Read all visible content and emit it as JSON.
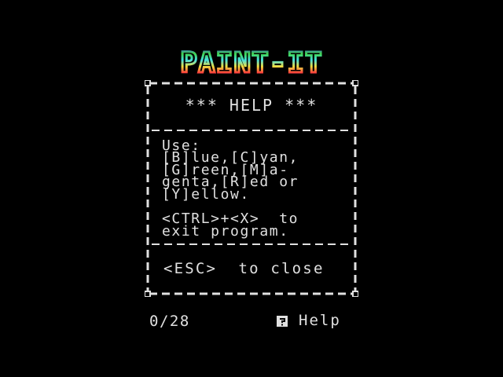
{
  "app": {
    "logo_text": "PAINT-IT"
  },
  "help_dialog": {
    "title": "*** HELP ***",
    "usage_text": "Use:\n[B]lue,[C]yan,\n[G]reen,[M]a-\ngenta,[R]ed or\n[Y]ellow.",
    "exit_text": "<CTRL>+<X>  to\nexit program.",
    "close_hint": "<ESC>  to close"
  },
  "status_bar": {
    "counter": "0/28",
    "help_icon": "question-box-icon",
    "help_label": "Help"
  },
  "colors": {
    "background": "#000000",
    "text": "#e0e0e0",
    "logo_blue": "#3a4bff",
    "logo_green": "#3fd34a",
    "logo_cyan": "#45e0e0",
    "logo_yellow": "#f0e040",
    "logo_red": "#ff3b3b",
    "logo_magenta": "#e040e0"
  }
}
